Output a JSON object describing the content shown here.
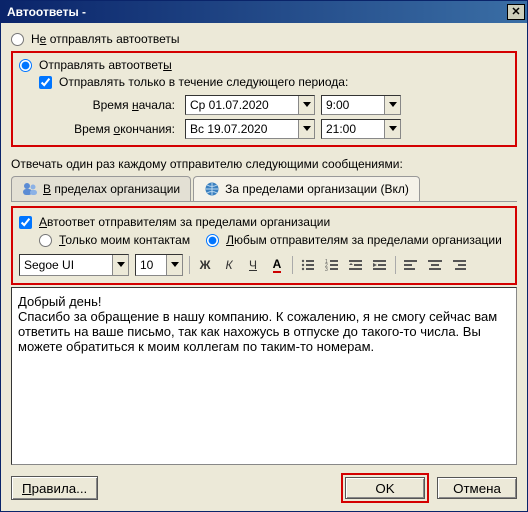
{
  "title": "Автоответы -",
  "radio_no_send": "Не отправлять автоответы",
  "radio_send": "Отправлять автоответы",
  "check_period": "Отправлять только в течение следующего периода:",
  "period": {
    "start_label": "Время начала:",
    "start_date": "Ср 01.07.2020",
    "start_time": "9:00",
    "end_label": "Время окончания:",
    "end_date": "Вс 19.07.2020",
    "end_time": "21:00"
  },
  "reply_once_label": "Отвечать один раз каждому отправителю следующими сообщениями:",
  "tabs": {
    "inside": "В пределах организации",
    "outside": "За пределами организации (Вкл)"
  },
  "outside_panel": {
    "auto_reply_outside": "Автоответ отправителям за пределами организации",
    "only_contacts": "Только моим контактам",
    "any_sender": "Любым отправителям за пределами организации"
  },
  "font": {
    "name": "Segoe UI",
    "size": "10"
  },
  "toolbar_letters": {
    "bold": "Ж",
    "italic": "К",
    "underline": "Ч"
  },
  "editor_text": "Добрый день!\nСпасибо за обращение в нашу компанию. К сожалению, я не смогу сейчас вам ответить на ваше письмо, так как нахожусь в отпуске до такого-то числа. Вы можете обратиться к моим коллегам по таким-то номерам.",
  "buttons": {
    "rules": "Правила...",
    "ok": "OK",
    "cancel": "Отмена"
  }
}
